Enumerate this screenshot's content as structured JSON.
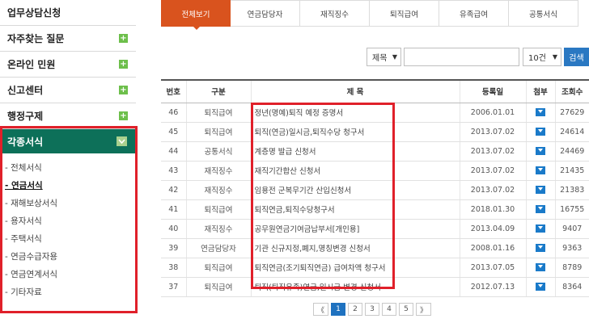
{
  "sidebar": {
    "items": [
      {
        "label": "업무상담신청"
      },
      {
        "label": "자주찾는 질문"
      },
      {
        "label": "온라인 민원"
      },
      {
        "label": "신고센터"
      },
      {
        "label": "행정구제"
      }
    ],
    "active": {
      "label": "각종서식"
    },
    "sub_items": [
      {
        "label": "- 전체서식"
      },
      {
        "label": "- 연금서식"
      },
      {
        "label": "- 재해보상서식"
      },
      {
        "label": "- 용자서식"
      },
      {
        "label": "- 주택서식"
      },
      {
        "label": "- 연금수급자용"
      },
      {
        "label": "- 연금연계서식"
      },
      {
        "label": "- 기타자료"
      }
    ]
  },
  "tabs": [
    {
      "label": "전체보기"
    },
    {
      "label": "연금담당자"
    },
    {
      "label": "재직징수"
    },
    {
      "label": "퇴직급여"
    },
    {
      "label": "유족급여"
    },
    {
      "label": "공통서식"
    }
  ],
  "search": {
    "field_select": "제목",
    "page_size_select": "10건",
    "query": "",
    "button_label": "검색"
  },
  "table": {
    "headers": [
      "번호",
      "구분",
      "제 목",
      "등록일",
      "첨부",
      "조회수"
    ],
    "rows": [
      {
        "no": "46",
        "cat": "퇴직급여",
        "title": "정년(명예)퇴직 예정 증명서",
        "date": "2006.01.01",
        "views": "27629"
      },
      {
        "no": "45",
        "cat": "퇴직급여",
        "title": "퇴직(연금)일시금,퇴직수당 청구서",
        "date": "2013.07.02",
        "views": "24614"
      },
      {
        "no": "44",
        "cat": "공통서식",
        "title": "계층명 발급 신청서",
        "date": "2013.07.02",
        "views": "24469"
      },
      {
        "no": "43",
        "cat": "재직징수",
        "title": "재직기간합산 신청서",
        "date": "2013.07.02",
        "views": "21435"
      },
      {
        "no": "42",
        "cat": "재직징수",
        "title": "임용전 군복무기간 산입신청서",
        "date": "2013.07.02",
        "views": "21383"
      },
      {
        "no": "41",
        "cat": "퇴직급여",
        "title": "퇴직연금,퇴직수당청구서",
        "date": "2018.01.30",
        "views": "16755"
      },
      {
        "no": "40",
        "cat": "재직징수",
        "title": "공무원연금기여금납부서[개인용]",
        "date": "2013.04.09",
        "views": "9407"
      },
      {
        "no": "39",
        "cat": "연금담당자",
        "title": "기관 신규지정,폐지,명칭변경 신청서",
        "date": "2008.01.16",
        "views": "9363"
      },
      {
        "no": "38",
        "cat": "퇴직급여",
        "title": "퇴직연금(조기퇴직연금) 급여차액 청구서",
        "date": "2013.07.05",
        "views": "8789"
      },
      {
        "no": "37",
        "cat": "퇴직급여",
        "title": "퇴직(퇴직유족)연금,일시금 변경 신청서",
        "date": "2012.07.13",
        "views": "8364"
      }
    ]
  },
  "pager": {
    "first": "《",
    "pages": [
      "1",
      "2",
      "3",
      "4",
      "5"
    ],
    "last": "》",
    "current": "1"
  },
  "colors": {
    "sidebar_active": "#0d7059",
    "tab_active": "#d9531e",
    "primary_blue": "#2a78c2",
    "highlight_red": "#e0202a"
  }
}
